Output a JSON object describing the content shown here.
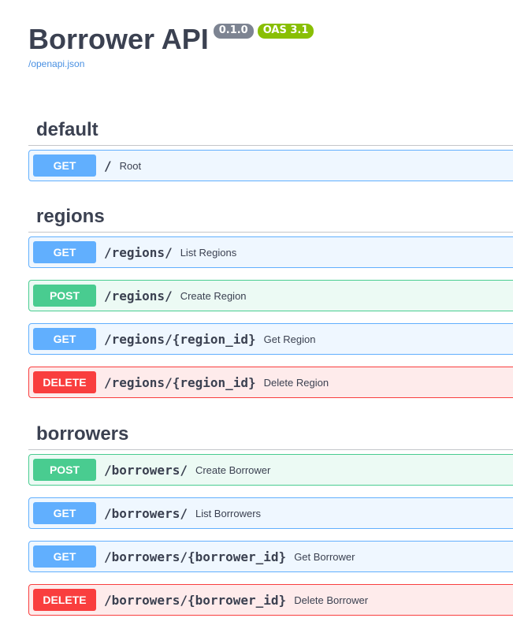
{
  "info": {
    "title": "Borrower API",
    "version": "0.1.0",
    "oas_version": "OAS 3.1",
    "spec_link": "/openapi.json"
  },
  "sections": [
    {
      "tag": "default",
      "operations": [
        {
          "method": "GET",
          "path": "/",
          "summary": "Root"
        }
      ]
    },
    {
      "tag": "regions",
      "operations": [
        {
          "method": "GET",
          "path": "/regions/",
          "summary": "List Regions"
        },
        {
          "method": "POST",
          "path": "/regions/",
          "summary": "Create Region"
        },
        {
          "method": "GET",
          "path": "/regions/{region_id}",
          "summary": "Get Region"
        },
        {
          "method": "DELETE",
          "path": "/regions/{region_id}",
          "summary": "Delete Region"
        }
      ]
    },
    {
      "tag": "borrowers",
      "operations": [
        {
          "method": "POST",
          "path": "/borrowers/",
          "summary": "Create Borrower"
        },
        {
          "method": "GET",
          "path": "/borrowers/",
          "summary": "List Borrowers"
        },
        {
          "method": "GET",
          "path": "/borrowers/{borrower_id}",
          "summary": "Get Borrower"
        },
        {
          "method": "DELETE",
          "path": "/borrowers/{borrower_id}",
          "summary": "Delete Borrower"
        }
      ]
    }
  ],
  "colors": {
    "get": "#61affe",
    "post": "#49cc90",
    "delete": "#f93e3e",
    "version_badge": "#7d8492",
    "oas_badge": "#89bf04",
    "link": "#4990e2"
  }
}
